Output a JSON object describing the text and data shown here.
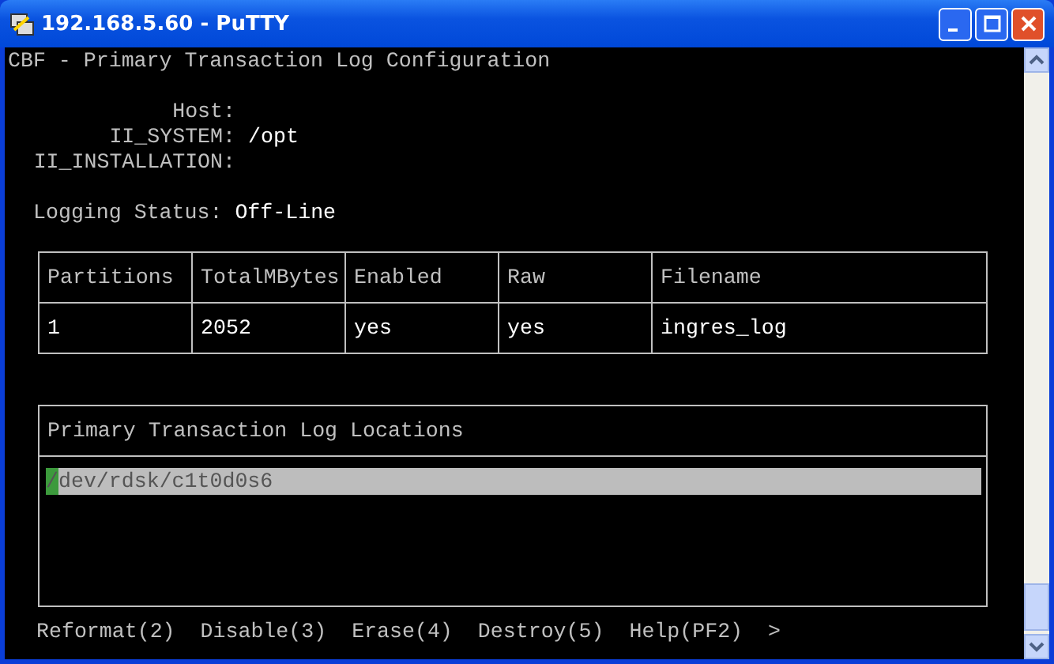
{
  "window": {
    "title": "192.168.5.60 - PuTTY"
  },
  "screen_title": "CBF - Primary Transaction Log Configuration",
  "fields": [
    {
      "label": "Host:"
    },
    {
      "label": "II_SYSTEM:",
      "value": "/opt"
    },
    {
      "label": "II_INSTALLATION:"
    }
  ],
  "logging_status": {
    "label": "Logging Status:",
    "value": "Off-Line"
  },
  "table": {
    "columns": [
      "Partitions",
      "TotalMBytes",
      "Enabled",
      "Raw",
      "Filename"
    ],
    "rows": [
      [
        "1",
        "2052",
        "yes",
        "yes",
        "ingres_log"
      ]
    ]
  },
  "locations": {
    "title": "Primary Transaction Log Locations",
    "items": [
      {
        "path": "/dev/rdsk/c1t0d0s6",
        "selected": true
      }
    ]
  },
  "menu": [
    "Reformat(2)",
    "Disable(3)",
    "Erase(4)",
    "Destroy(5)",
    "Help(PF2)",
    ">"
  ]
}
